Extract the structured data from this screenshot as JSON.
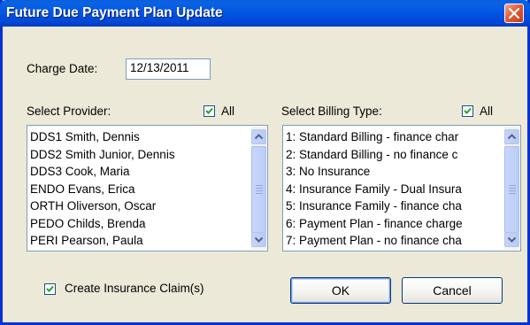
{
  "window": {
    "title": "Future Due Payment Plan Update",
    "close_icon": "close-x-icon"
  },
  "charge_date": {
    "label": "Charge Date:",
    "value": "12/13/2011"
  },
  "provider": {
    "label": "Select Provider:",
    "all_label": "All",
    "all_checked": true,
    "items": [
      "DDS1 Smith, Dennis",
      "DDS2 Smith Junior, Dennis",
      "DDS3 Cook, Maria",
      "ENDO Evans, Erica",
      "ORTH Oliverson, Oscar",
      "PEDO Childs, Brenda",
      "PERI Pearson, Paula"
    ]
  },
  "billing_type": {
    "label": "Select Billing Type:",
    "all_label": "All",
    "all_checked": true,
    "items": [
      "1: Standard Billing - finance char",
      "2: Standard Billing - no finance c",
      "3: No Insurance",
      "4: Insurance Family - Dual Insura",
      "5: Insurance Family - finance cha",
      "6: Payment Plan - finance charge",
      "7: Payment Plan - no finance cha"
    ]
  },
  "create_claims": {
    "label": "Create Insurance Claim(s)",
    "checked": true
  },
  "buttons": {
    "ok": "OK",
    "cancel": "Cancel"
  },
  "colors": {
    "titlebar": "#0054e3",
    "window_bg": "#ece9d8",
    "close_button": "#e45d37"
  }
}
